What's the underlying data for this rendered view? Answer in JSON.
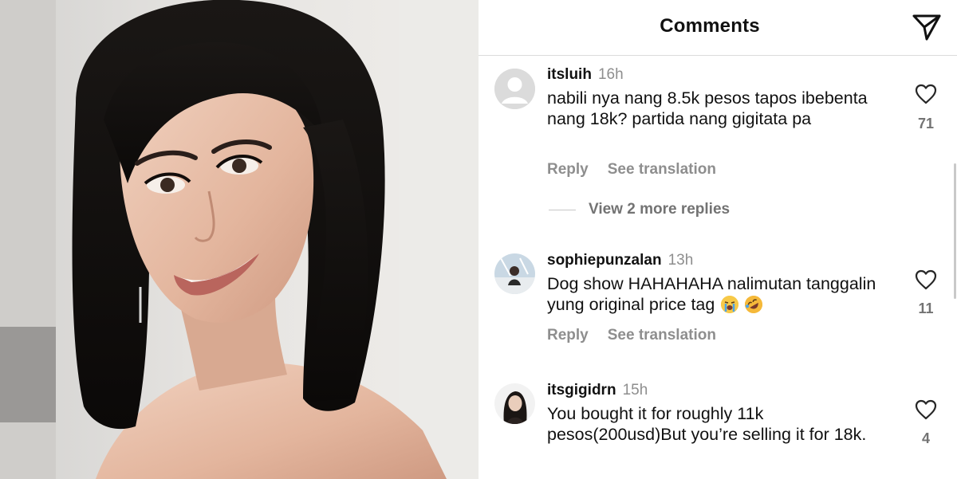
{
  "header": {
    "title": "Comments",
    "send_icon": "paper-plane-icon"
  },
  "comments": [
    {
      "username": "itsluih",
      "time": "16h",
      "text": "nabili nya nang 8.5k pesos tapos ibebenta nang 18k? partida nang gigitata pa",
      "reply_label": "Reply",
      "translation_label": "See translation",
      "likes": "71",
      "avatar": "default-avatar"
    },
    {
      "username": "sophiepunzalan",
      "time": "13h",
      "text": "Dog show HAHAHAHA nalimutan tanggalin yung original price tag",
      "emojis": [
        "loudly-crying-face",
        "rolling-on-floor-laughing-face"
      ],
      "reply_label": "Reply",
      "translation_label": "See translation",
      "likes": "11",
      "avatar": "photo-avatar"
    },
    {
      "username": "itsgigidrn",
      "time": "15h",
      "text": "You bought it for roughly 11k pesos(200usd)But you’re selling it for 18k.",
      "likes": "4",
      "avatar": "photo-avatar"
    }
  ],
  "view_more_replies": "View 2 more replies",
  "colors": {
    "text": "#111111",
    "secondary": "#8e8e8e",
    "divider": "#dbdbdb"
  }
}
